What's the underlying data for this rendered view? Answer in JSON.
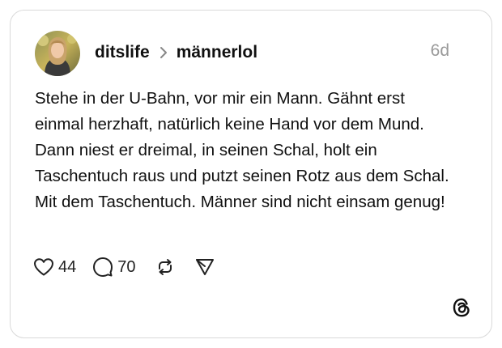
{
  "post": {
    "author": "ditslife",
    "community": "männerlol",
    "time": "6d",
    "text": "Stehe in der U-Bahn, vor mir ein Mann. Gähnt erst einmal herzhaft, natürlich keine Hand vor dem Mund. Dann niest er dreimal, in seinen Schal, holt ein Taschentuch raus und putzt seinen Rotz aus dem Schal. Mit dem Taschentuch. Männer sind nicht einsam genug!",
    "likes": "44",
    "comments": "70"
  },
  "icons": {
    "chevron": "chevron-right-icon",
    "like": "heart-icon",
    "comment": "comment-bubble-icon",
    "repost": "repost-icon",
    "share": "send-icon",
    "brand": "threads-logo-icon"
  },
  "colors": {
    "text": "#101010",
    "muted": "#999999",
    "border": "#d9d9d9"
  }
}
